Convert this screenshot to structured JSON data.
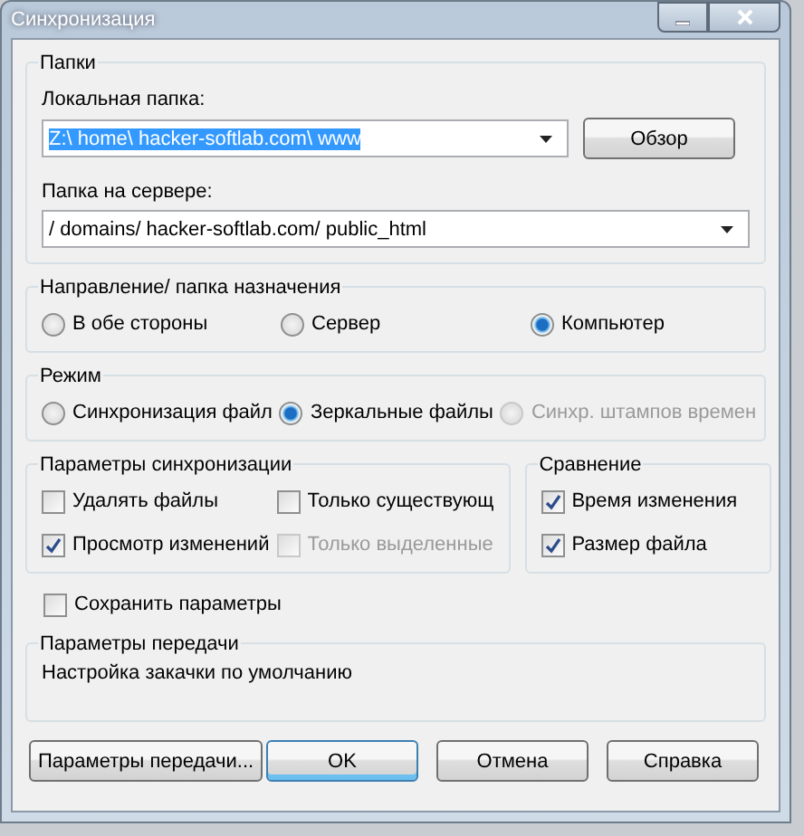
{
  "window": {
    "title": "Синхронизация"
  },
  "folders": {
    "title": "Папки",
    "local": {
      "label": "Локальная папка:",
      "value": "Z:\\ home\\ hacker-softlab.com\\ www",
      "text_selected": true
    },
    "browse_button": "Обзор",
    "server": {
      "label": "Папка на сервере:",
      "value": "/ domains/ hacker-softlab.com/ public_html"
    }
  },
  "direction": {
    "title": "Направление/ папка назначения",
    "options": [
      {
        "label": "В обе стороны",
        "selected": false,
        "disabled": false
      },
      {
        "label": "Сервер",
        "selected": false,
        "disabled": false
      },
      {
        "label": "Компьютер",
        "selected": true,
        "disabled": false
      }
    ]
  },
  "mode": {
    "title": "Режим",
    "options": [
      {
        "label": "Синхронизация файл",
        "selected": false,
        "disabled": false
      },
      {
        "label": "Зеркальные файлы",
        "selected": true,
        "disabled": false
      },
      {
        "label": "Синхр. штампов времен",
        "selected": false,
        "disabled": true
      }
    ]
  },
  "sync_options": {
    "title": "Параметры синхронизации",
    "items": [
      {
        "label": "Удалять файлы",
        "checked": false,
        "disabled": false
      },
      {
        "label": "Только существующ",
        "checked": false,
        "disabled": false
      },
      {
        "label": "Просмотр изменений",
        "checked": true,
        "disabled": false
      },
      {
        "label": "Только выделенные",
        "checked": false,
        "disabled": true
      }
    ]
  },
  "compare": {
    "title": "Сравнение",
    "items": [
      {
        "label": "Время изменения",
        "checked": true,
        "disabled": false
      },
      {
        "label": "Размер файла",
        "checked": true,
        "disabled": false
      }
    ]
  },
  "save_params": {
    "label": "Сохранить параметры",
    "checked": false
  },
  "transfer": {
    "title": "Параметры передачи",
    "text": "Настройка закачки по умолчанию"
  },
  "buttons": [
    {
      "label": "Параметры передачи...",
      "default": false
    },
    {
      "label": "OK",
      "default": true
    },
    {
      "label": "Отмена",
      "default": false
    },
    {
      "label": "Справка",
      "default": false
    }
  ]
}
